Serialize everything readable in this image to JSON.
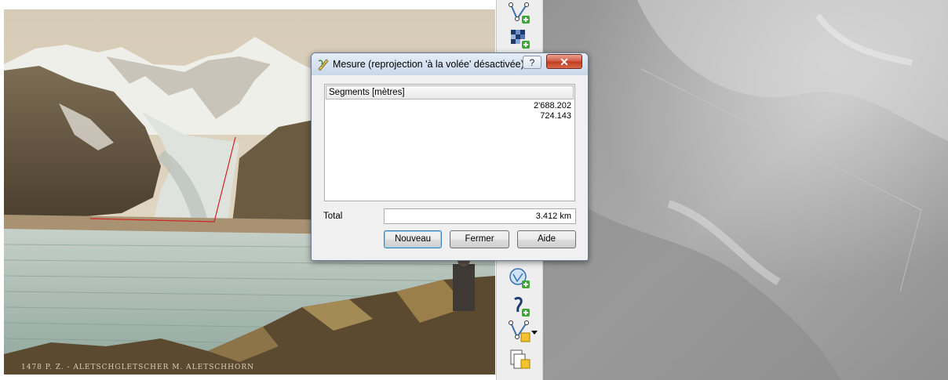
{
  "dialog": {
    "title": "Mesure (reprojection 'à la volée' désactivée)",
    "help_label": "?",
    "close_label": "✕",
    "segments_header": "Segments [mètres]",
    "segments": [
      "2'688.202",
      "724.143"
    ],
    "total_label": "Total",
    "total_value": "3.412 km",
    "buttons": {
      "new": "Nouveau",
      "close": "Fermer",
      "help": "Aide"
    }
  },
  "photo": {
    "caption": "1478 P. Z. - ALETSCHGLETSCHER M. ALETSCHHORN"
  },
  "toolbar": {
    "icons": [
      "add-vector-layer-icon",
      "add-raster-layer-icon",
      "add-wms-layer-icon",
      "add-delimited-text-icon",
      "new-shapefile-icon",
      "add-layer-dropdown-icon",
      "paste-layer-icon"
    ]
  },
  "colors": {
    "measure_line": "#d42020",
    "dialog_bg": "#f0f0f0",
    "close_red": "#c8452d"
  }
}
